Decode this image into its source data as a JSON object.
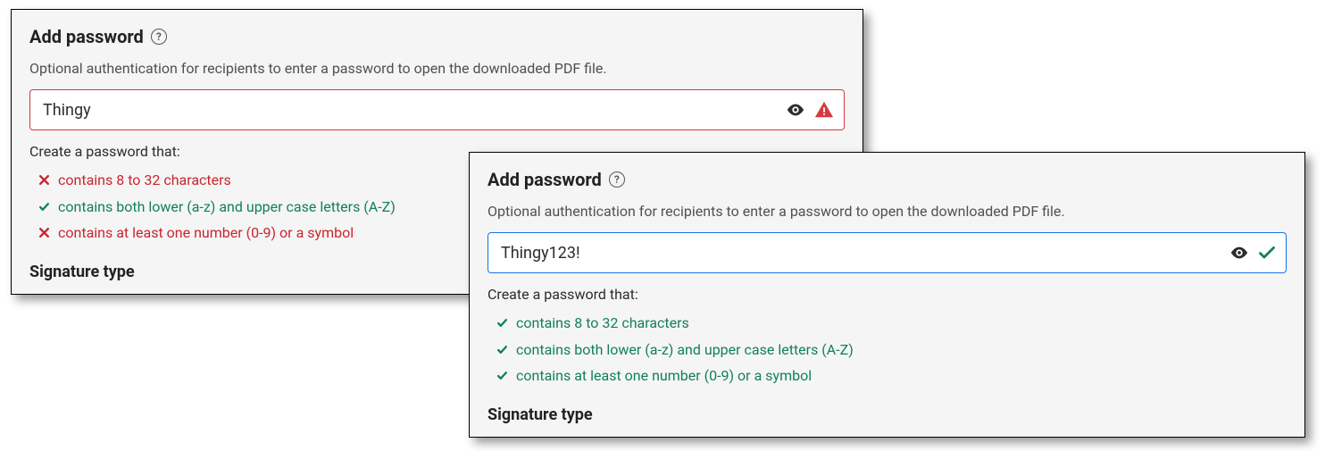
{
  "colors": {
    "error": "#d7373f",
    "error_text": "#c9252d",
    "success": "#12805c",
    "focus": "#1473e6"
  },
  "left": {
    "title": "Add password",
    "description": "Optional authentication for recipients to enter a password to open the downloaded PDF file.",
    "input_value": "Thingy",
    "rules_label": "Create a password that:",
    "rules": [
      {
        "text": "contains 8 to 32 characters",
        "status": "fail"
      },
      {
        "text": "contains both lower (a-z) and upper case letters (A-Z)",
        "status": "pass"
      },
      {
        "text": "contains at least one number (0-9) or a symbol",
        "status": "fail"
      }
    ],
    "next_section": "Signature type"
  },
  "right": {
    "title": "Add password",
    "description": "Optional authentication for recipients to enter a password to open the downloaded PDF file.",
    "input_value": "Thingy123!",
    "rules_label": "Create a password that:",
    "rules": [
      {
        "text": "contains 8 to 32 characters",
        "status": "pass"
      },
      {
        "text": "contains both lower (a-z) and upper case letters (A-Z)",
        "status": "pass"
      },
      {
        "text": "contains at least one number (0-9) or a symbol",
        "status": "pass"
      }
    ],
    "next_section": "Signature type"
  }
}
